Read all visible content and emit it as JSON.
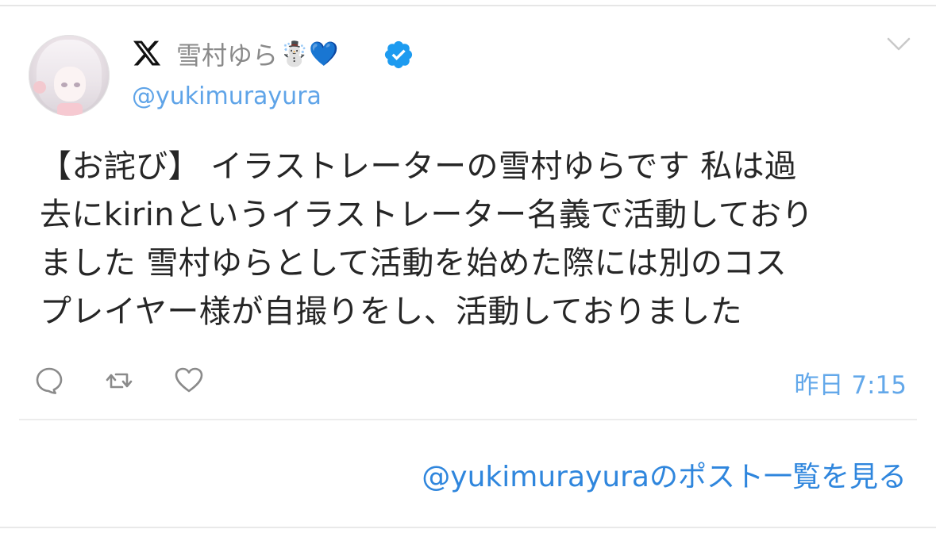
{
  "user": {
    "display_name": "雪村ゆら",
    "name_emoji": "☃️💙",
    "handle": "@yukimurayura",
    "verified": true,
    "avatar_icon": "avatar-image"
  },
  "brand": {
    "logo": "x-logo-icon",
    "accent": "#1d9bf0"
  },
  "tweet": {
    "lines": [
      "【お詫び】 イラストレーターの雪村ゆらです 私は過",
      "去にkirinというイラストレーター名義で活動しており",
      "ました 雪村ゆらとして活動を始めた際には別のコス",
      "プレイヤー様が自撮りをし、活動しておりました"
    ],
    "timestamp": "昨日 7:15"
  },
  "actions": [
    {
      "name": "reply-icon"
    },
    {
      "name": "retweet-icon"
    },
    {
      "name": "like-icon"
    }
  ],
  "footer": {
    "view_posts_label": "@yukimurayuraのポスト一覧を見る"
  },
  "colors": {
    "text": "#262626",
    "handle": "#5fa4e8",
    "link": "#2f86dd",
    "muted": "#8a8a8a"
  }
}
